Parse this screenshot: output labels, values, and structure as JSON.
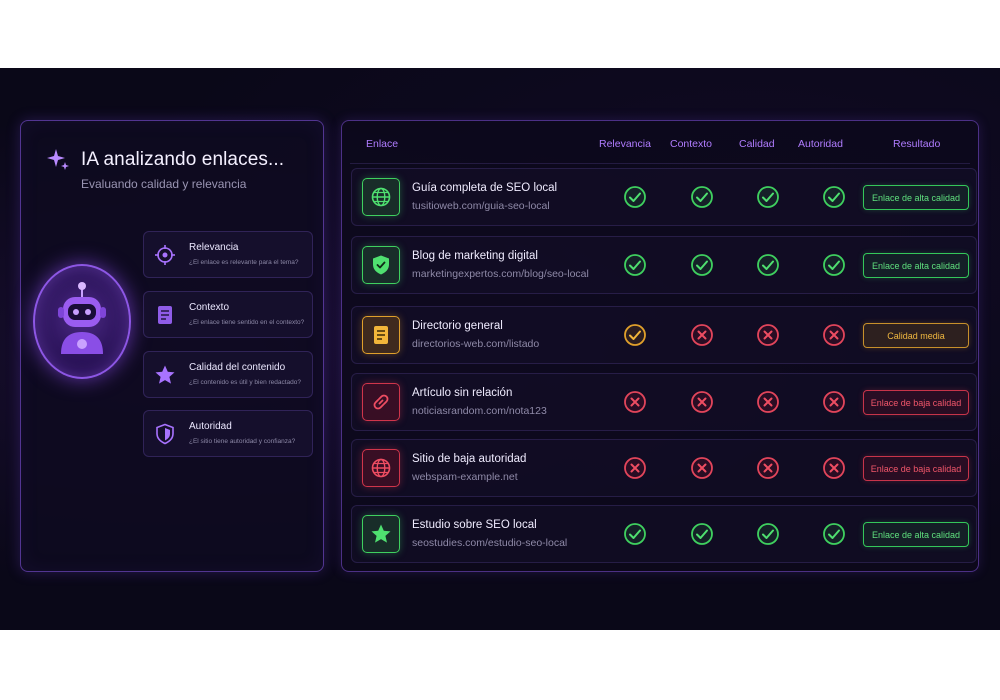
{
  "colors": {
    "accent": "#b07cff",
    "success": "#3fd05f",
    "warning": "#e0a02b",
    "danger": "#e2455b",
    "background": "#0a0818"
  },
  "left_panel": {
    "title": "IA analizando enlaces...",
    "subtitle": "Evaluando calidad y relevancia",
    "title_icon": "sparkle-icon",
    "avatar_icon": "robot-icon",
    "criteria": [
      {
        "title": "Relevancia",
        "question": "¿El enlace es relevante para el tema?",
        "icon": "target-icon"
      },
      {
        "title": "Contexto",
        "question": "¿El enlace tiene sentido en el contexto?",
        "icon": "document-icon"
      },
      {
        "title": "Calidad del contenido",
        "question": "¿El contenido es útil y bien redactado?",
        "icon": "star-icon"
      },
      {
        "title": "Autoridad",
        "question": "¿El sitio tiene autoridad y confianza?",
        "icon": "shield-icon"
      }
    ]
  },
  "table": {
    "headers": {
      "link": "Enlace",
      "relevance": "Relevancia",
      "context": "Contexto",
      "quality": "Calidad",
      "authority": "Autoridad",
      "result": "Resultado"
    },
    "rows": [
      {
        "title": "Guía completa de SEO local",
        "url": "tusitioweb.com/guia-seo-local",
        "icon": "globe-icon",
        "tone": "green",
        "checks": [
          "pass",
          "pass",
          "pass",
          "pass"
        ],
        "result": "Enlace de alta calidad"
      },
      {
        "title": "Blog de marketing digital",
        "url": "marketingexpertos.com/blog/seo-local",
        "icon": "shield-icon",
        "tone": "green",
        "checks": [
          "pass",
          "pass",
          "pass",
          "pass"
        ],
        "result": "Enlace de alta calidad"
      },
      {
        "title": "Directorio general",
        "url": "directorios-web.com/listado",
        "icon": "document-icon",
        "tone": "amber",
        "checks": [
          "warn",
          "fail",
          "fail",
          "fail"
        ],
        "result": "Calidad media"
      },
      {
        "title": "Artículo sin relación",
        "url": "noticiasrandom.com/nota123",
        "icon": "link-icon",
        "tone": "red",
        "checks": [
          "fail",
          "fail",
          "fail",
          "fail"
        ],
        "result": "Enlace de baja calidad"
      },
      {
        "title": "Sitio de baja autoridad",
        "url": "webspam-example.net",
        "icon": "globe-icon",
        "tone": "red",
        "checks": [
          "fail",
          "fail",
          "fail",
          "fail"
        ],
        "result": "Enlace de baja calidad"
      },
      {
        "title": "Estudio sobre SEO local",
        "url": "seostudies.com/estudio-seo-local",
        "icon": "star-icon",
        "tone": "green",
        "checks": [
          "pass",
          "pass",
          "pass",
          "pass"
        ],
        "result": "Enlace de alta calidad"
      }
    ]
  }
}
